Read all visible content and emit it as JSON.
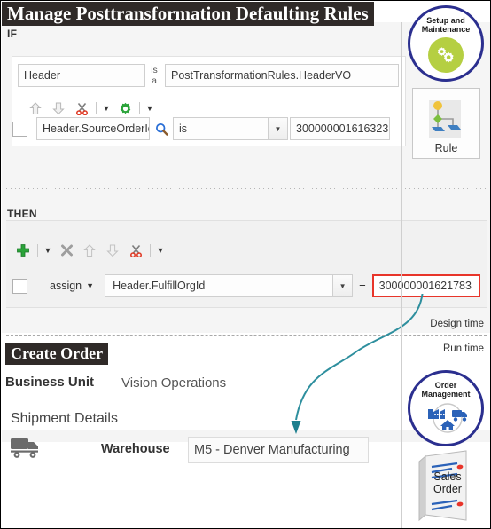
{
  "window": {
    "title": "Manage Posttransformation Defaulting Rules"
  },
  "design_time": {
    "if_label": "IF",
    "then_label": "THEN",
    "if_binding": {
      "object_name": "Header",
      "is_a_label": "is a",
      "view_object": "PostTransformationRules.HeaderVO"
    },
    "if_toolbar": [
      {
        "name": "move-up-icon",
        "glyph": "up-arrow"
      },
      {
        "name": "move-down-icon",
        "glyph": "down-arrow"
      },
      {
        "name": "cut-icon",
        "glyph": "scissors"
      },
      {
        "name": "cut-menu-caret-icon",
        "glyph": "caret-down"
      },
      {
        "name": "settings-icon",
        "glyph": "gear"
      },
      {
        "name": "settings-menu-caret-icon",
        "glyph": "caret-down"
      }
    ],
    "condition_row": {
      "checkbox_checked": false,
      "attribute": "Header.SourceOrderId",
      "search_icon": "magnifier-icon",
      "operator": "is",
      "value": "300000001616323"
    },
    "then_toolbar": [
      {
        "name": "add-icon",
        "glyph": "plus"
      },
      {
        "name": "add-menu-caret-icon",
        "glyph": "caret-down"
      },
      {
        "name": "delete-icon",
        "glyph": "x-mark"
      },
      {
        "name": "move-up-icon",
        "glyph": "up-arrow"
      },
      {
        "name": "move-down-icon",
        "glyph": "down-arrow"
      },
      {
        "name": "cut-icon",
        "glyph": "scissors"
      },
      {
        "name": "cut-menu-caret-icon",
        "glyph": "caret-down"
      }
    ],
    "action_row": {
      "checkbox_checked": false,
      "action": "assign",
      "target": "Header.FulfillOrgId",
      "equals_sign": "=",
      "value": "300000001621783",
      "value_border_color": "#e8352a"
    }
  },
  "separator": {
    "design_time_label": "Design time",
    "run_time_label": "Run time"
  },
  "run_time": {
    "page_title": "Create Order",
    "business_unit_label": "Business Unit",
    "business_unit_value": "Vision Operations",
    "section_title": "Shipment Details",
    "shipping_icon": "truck-icon",
    "warehouse_label": "Warehouse",
    "warehouse_value": "M5 - Denver Manufacturing"
  },
  "right_rail": {
    "setup_badge": {
      "line1": "Setup and",
      "line2": "Maintenance",
      "icon": "gears-icon",
      "disc_color": "#b5cf42",
      "ring_color": "#2b2f8f"
    },
    "rule_tile": {
      "label": "Rule",
      "icon": "rule-tree-icon"
    },
    "order_management_badge": {
      "line1": "Order",
      "line2": "Management",
      "icon": "factory-home-truck-icon",
      "ring_color": "#2b2f8f"
    },
    "sales_order_tile": {
      "line1": "Sales",
      "line2": "Order",
      "icon": "document-icon"
    }
  },
  "connector": {
    "name": "value-to-warehouse-arrow",
    "color": "#2e8f9e"
  }
}
